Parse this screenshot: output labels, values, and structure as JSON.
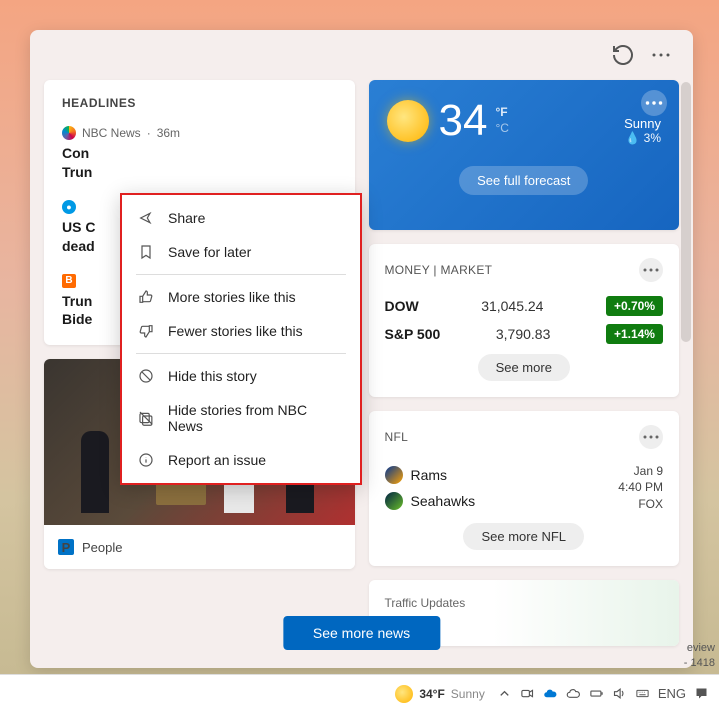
{
  "headlines": {
    "title": "HEADLINES",
    "story1": {
      "source": "NBC News",
      "time": "36m",
      "title_visible": "Con\nTrun"
    },
    "story2": {
      "title_visible": "US C\ndead"
    },
    "story3": {
      "title_visible": "Trun\nBide"
    }
  },
  "context_menu": {
    "share": "Share",
    "save": "Save for later",
    "more": "More stories like this",
    "fewer": "Fewer stories like this",
    "hide": "Hide this story",
    "hide_source": "Hide stories from NBC News",
    "report": "Report an issue"
  },
  "image_card": {
    "source": "People"
  },
  "weather": {
    "temp": "34",
    "unit_f": "°F",
    "unit_c": "°C",
    "condition": "Sunny",
    "precip": "3%",
    "button": "See full forecast"
  },
  "market": {
    "section": "MONEY | MARKET",
    "rows": [
      {
        "name": "DOW",
        "value": "31,045.24",
        "pct": "+0.70%"
      },
      {
        "name": "S&P 500",
        "value": "3,790.83",
        "pct": "+1.14%"
      }
    ],
    "button": "See more"
  },
  "nfl": {
    "section": "NFL",
    "team1": "Rams",
    "team2": "Seahawks",
    "date": "Jan 9",
    "time": "4:40 PM",
    "network": "FOX",
    "button": "See more NFL"
  },
  "traffic": {
    "section": "Traffic Updates"
  },
  "see_more_news": "See more news",
  "taskbar": {
    "temp": "34°F",
    "cond": "Sunny",
    "lang": "ENG"
  },
  "overlay": {
    "l1": "eview",
    "l2": "- 1418"
  }
}
